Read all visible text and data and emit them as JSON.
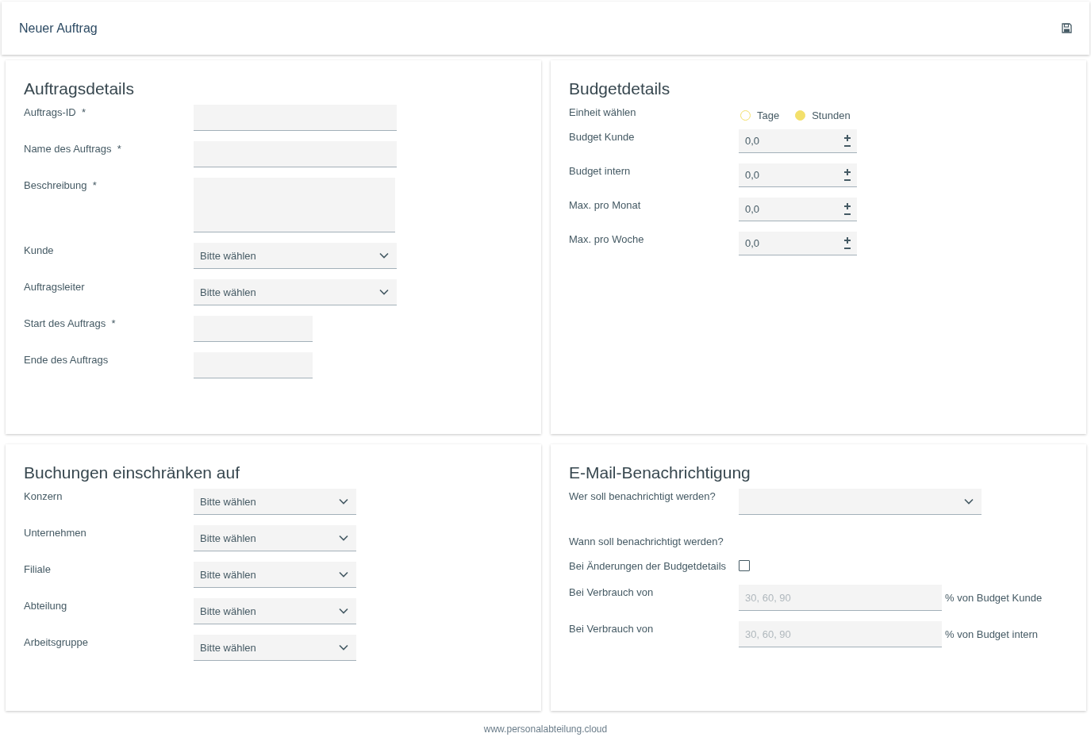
{
  "header": {
    "title": "Neuer Auftrag"
  },
  "order_details": {
    "title": "Auftragsdetails",
    "fields": [
      {
        "label": "Auftrags-ID",
        "marker": "*",
        "kind": "text"
      },
      {
        "label": "Name des Auftrags",
        "marker": "*",
        "kind": "text"
      },
      {
        "label": "Beschreibung",
        "marker": "*",
        "kind": "textarea"
      },
      {
        "label": "Kunde",
        "kind": "select",
        "value": "Bitte wählen"
      },
      {
        "label": "Auftragsleiter",
        "kind": "select",
        "value": "Bitte wählen"
      },
      {
        "label": "Start des Auftrags",
        "marker": "*",
        "kind": "date"
      },
      {
        "label": "Ende des Auftrags",
        "kind": "date"
      }
    ]
  },
  "budget_details": {
    "title": "Budgetdetails",
    "unit": {
      "label": "Einheit wählen",
      "options": [
        {
          "label": "Tage",
          "selected": false
        },
        {
          "label": "Stunden",
          "selected": true
        }
      ]
    },
    "fields": [
      {
        "label": "Budget Kunde",
        "value": "0,0"
      },
      {
        "label": "Budget intern",
        "value": "0,0"
      },
      {
        "label": "Max. pro Monat",
        "value": "0,0"
      },
      {
        "label": "Max. pro Woche",
        "value": "0,0"
      }
    ]
  },
  "booking_restrictions": {
    "title": "Buchungen einschränken auf",
    "fields": [
      {
        "label": "Konzern",
        "value": "Bitte wählen"
      },
      {
        "label": "Unternehmen",
        "value": "Bitte wählen"
      },
      {
        "label": "Filiale",
        "value": "Bitte wählen"
      },
      {
        "label": "Abteilung",
        "value": "Bitte wählen"
      },
      {
        "label": "Arbeitsgruppe",
        "value": "Bitte wählen"
      }
    ]
  },
  "email_notification": {
    "title": "E-Mail-Benachrichtigung",
    "recipients": {
      "label": "Wer soll benachrichtigt werden?"
    },
    "when_label": "Wann soll benachrichtigt werden?",
    "budget_change": {
      "label": "Bei Änderungen der Budgetdetails",
      "checked": false
    },
    "thresholds": [
      {
        "label": "Bei Verbrauch von",
        "placeholder": "30, 60, 90",
        "suffix": "% von Budget Kunde"
      },
      {
        "label": "Bei Verbrauch von",
        "placeholder": "30, 60, 90",
        "suffix": "% von Budget intern"
      }
    ]
  },
  "footer": {
    "text": "www.personalabteilung.cloud"
  }
}
